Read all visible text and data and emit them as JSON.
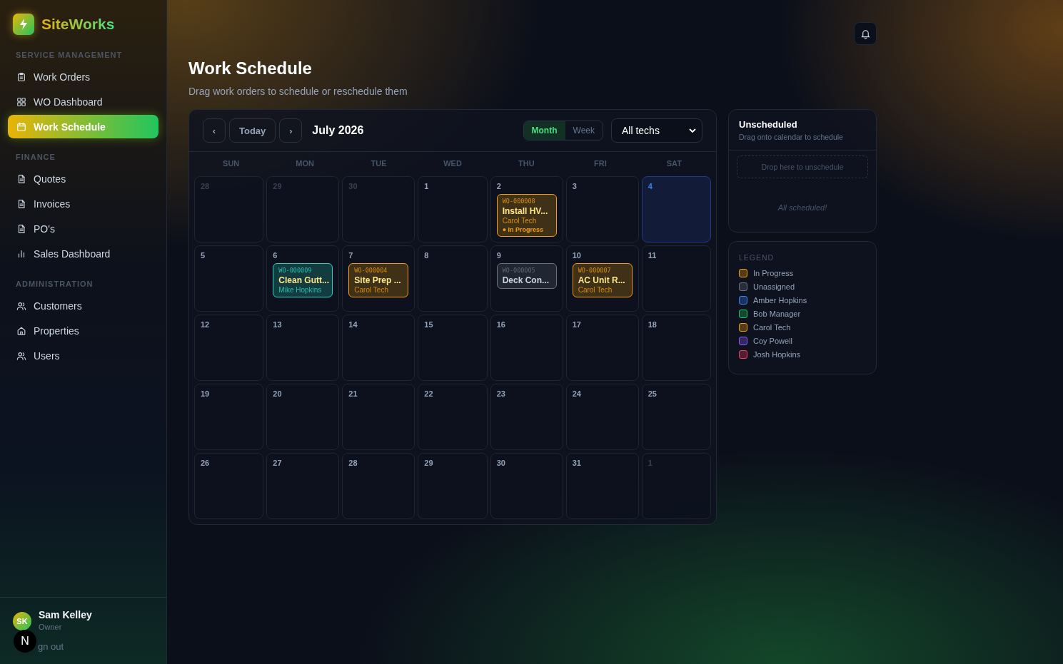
{
  "brand": "SiteWorks",
  "sidebar": {
    "sections": [
      {
        "title": "SERVICE MANAGEMENT",
        "items": [
          {
            "label": "Work Orders",
            "kind": "clipboard",
            "selected": false
          },
          {
            "label": "WO Dashboard",
            "kind": "grid",
            "selected": false
          },
          {
            "label": "Work Schedule",
            "kind": "calendar",
            "selected": true
          }
        ]
      },
      {
        "title": "FINANCE",
        "items": [
          {
            "label": "Quotes",
            "kind": "document",
            "selected": false
          },
          {
            "label": "Invoices",
            "kind": "document",
            "selected": false
          },
          {
            "label": "PO's",
            "kind": "document",
            "selected": false
          },
          {
            "label": "Sales Dashboard",
            "kind": "chart",
            "selected": false
          }
        ]
      },
      {
        "title": "ADMINISTRATION",
        "items": [
          {
            "label": "Customers",
            "kind": "people",
            "selected": false
          },
          {
            "label": "Properties",
            "kind": "home",
            "selected": false
          },
          {
            "label": "Users",
            "kind": "people",
            "selected": false
          }
        ]
      }
    ]
  },
  "user": {
    "initials": "SK",
    "name": "Sam Kelley",
    "role": "Owner",
    "signout": "gn out",
    "badge": "N"
  },
  "page": {
    "title": "Work Schedule",
    "subtitle": "Drag work orders to schedule or reschedule them"
  },
  "calendar": {
    "prev": "‹",
    "today": "Today",
    "next": "›",
    "month": "July 2026",
    "views": [
      {
        "label": "Month",
        "selected": true
      },
      {
        "label": "Week",
        "selected": false
      }
    ],
    "filter": "All techs",
    "weekdays": [
      "SUN",
      "MON",
      "TUE",
      "WED",
      "THU",
      "FRI",
      "SAT"
    ],
    "days": [
      {
        "day": "28",
        "muted": true,
        "today": false
      },
      {
        "day": "29",
        "muted": true,
        "today": false
      },
      {
        "day": "30",
        "muted": true,
        "today": false
      },
      {
        "day": "1",
        "muted": false,
        "today": false
      },
      {
        "day": "2",
        "muted": false,
        "today": false,
        "events": [
          {
            "wo": "WO-000008",
            "title": "Install HV...",
            "tech": "Carol Tech",
            "status": "● In Progress",
            "color": "#f59e0b"
          }
        ]
      },
      {
        "day": "3",
        "muted": false,
        "today": false
      },
      {
        "day": "4",
        "muted": false,
        "today": true
      },
      {
        "day": "5",
        "muted": false,
        "today": false
      },
      {
        "day": "6",
        "muted": false,
        "today": false,
        "events": [
          {
            "wo": "WO-000009",
            "title": "Clean Gutt...",
            "tech": "Mike Hopkins",
            "color": "#2dd4bf"
          }
        ]
      },
      {
        "day": "7",
        "muted": false,
        "today": false,
        "events": [
          {
            "wo": "WO-000004",
            "title": "Site Prep ...",
            "tech": "Carol Tech",
            "color": "#f59e0b"
          }
        ]
      },
      {
        "day": "8",
        "muted": false,
        "today": false
      },
      {
        "day": "9",
        "muted": false,
        "today": false,
        "events": [
          {
            "wo": "WO-000005",
            "title": "Deck Con...",
            "color": "#6b7280"
          }
        ]
      },
      {
        "day": "10",
        "muted": false,
        "today": false,
        "events": [
          {
            "wo": "WO-000007",
            "title": "AC Unit R...",
            "tech": "Carol Tech",
            "color": "#f59e0b"
          }
        ]
      },
      {
        "day": "11",
        "muted": false,
        "today": false
      },
      {
        "day": "12",
        "muted": false,
        "today": false
      },
      {
        "day": "13",
        "muted": false,
        "today": false
      },
      {
        "day": "14",
        "muted": false,
        "today": false
      },
      {
        "day": "15",
        "muted": false,
        "today": false
      },
      {
        "day": "16",
        "muted": false,
        "today": false
      },
      {
        "day": "17",
        "muted": false,
        "today": false
      },
      {
        "day": "18",
        "muted": false,
        "today": false
      },
      {
        "day": "19",
        "muted": false,
        "today": false
      },
      {
        "day": "20",
        "muted": false,
        "today": false
      },
      {
        "day": "21",
        "muted": false,
        "today": false
      },
      {
        "day": "22",
        "muted": false,
        "today": false
      },
      {
        "day": "23",
        "muted": false,
        "today": false
      },
      {
        "day": "24",
        "muted": false,
        "today": false
      },
      {
        "day": "25",
        "muted": false,
        "today": false
      },
      {
        "day": "26",
        "muted": false,
        "today": false
      },
      {
        "day": "27",
        "muted": false,
        "today": false
      },
      {
        "day": "28",
        "muted": false,
        "today": false
      },
      {
        "day": "29",
        "muted": false,
        "today": false
      },
      {
        "day": "30",
        "muted": false,
        "today": false
      },
      {
        "day": "31",
        "muted": false,
        "today": false
      },
      {
        "day": "1",
        "muted": true,
        "today": false
      }
    ]
  },
  "unscheduled": {
    "title": "Unscheduled",
    "subtitle": "Drag onto calendar to schedule",
    "drop": "Drop here to unschedule",
    "empty": "All scheduled!"
  },
  "legend": {
    "title": "LEGEND",
    "items": [
      {
        "label": "In Progress",
        "color": "#f59e0b"
      },
      {
        "label": "Unassigned",
        "color": "#6b7280"
      },
      {
        "label": "Amber Hopkins",
        "color": "#3b82f6"
      },
      {
        "label": "Bob Manager",
        "color": "#22c55e"
      },
      {
        "label": "Carol Tech",
        "color": "#f59e0b"
      },
      {
        "label": "Coy Powell",
        "color": "#8b5cf6"
      },
      {
        "label": "Josh Hopkins",
        "color": "#f43f5e"
      }
    ]
  }
}
